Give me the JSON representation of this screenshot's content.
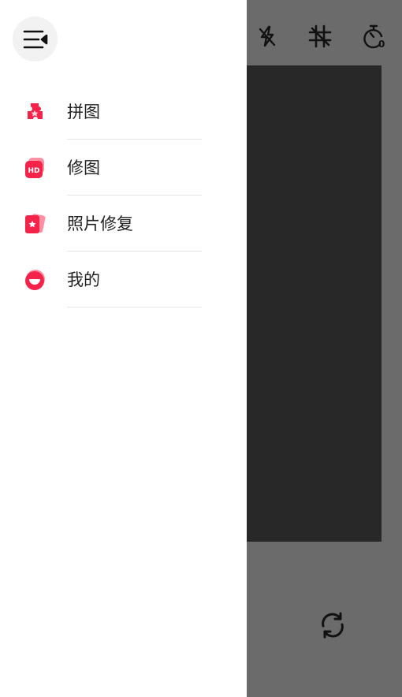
{
  "colors": {
    "accent": "#f5234a",
    "accent_light": "#ff7f95",
    "drawer_bg": "#ffffff",
    "overlay": "#6b6b6b",
    "preview": "#282828"
  },
  "drawer": {
    "menu_icon": "menu-collapse-icon",
    "items": [
      {
        "label": "拼图",
        "icon": "puzzle-icon"
      },
      {
        "label": "修图",
        "icon": "hd-photo-icon"
      },
      {
        "label": "照片修复",
        "icon": "photo-restore-icon"
      },
      {
        "label": "我的",
        "icon": "profile-icon"
      }
    ]
  },
  "camera": {
    "toolbar_icons": [
      "flash-off-icon",
      "grid-off-icon",
      "timer-icon"
    ],
    "timer_value": "0",
    "switch_icon": "switch-camera-icon"
  }
}
